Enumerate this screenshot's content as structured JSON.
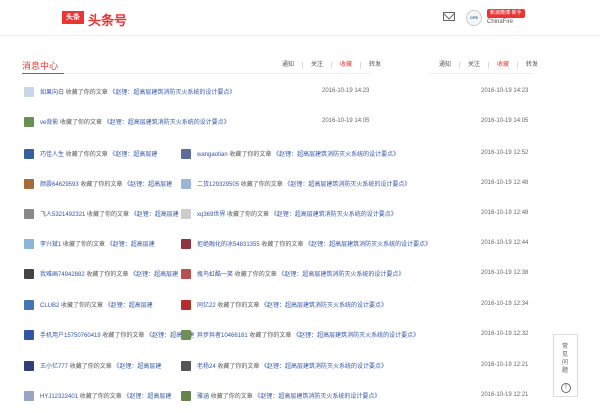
{
  "header": {
    "logo_text": "头条",
    "app_title": "头条号",
    "badge": "新浪微博·新手",
    "user_name": "ChinaFire",
    "avatar_text": "CFE"
  },
  "page": {
    "title": "消息中心",
    "tabs_left": [
      "通知",
      "关注",
      "收藏",
      "转发"
    ],
    "tabs_right": [
      "通知",
      "关注",
      "收藏",
      "转发"
    ]
  },
  "rows": [
    {
      "name": "如果向白",
      "action": "收藏了你的文章",
      "article": "《赵锂：超高层建筑消防灭火系统的设计要点》",
      "time": "2016-10-19 14:23"
    },
    {
      "name": "ve背影",
      "action": "收藏了你的文章",
      "article": "《赵锂：超高层建筑消防灭火系统的设计要点》",
      "time": "2016-10-19 14:05"
    },
    {
      "name": "巧佳人生",
      "action": "收藏了你的文章",
      "article": "《赵锂：超高层建",
      "time": "2016-10-19 12:52"
    },
    {
      "name": "颜震64629593",
      "action": "收藏了你的文章",
      "article": "《赵锂：超高层建",
      "time": "2016-10-19 12:48"
    },
    {
      "name": "飞人5321492321",
      "action": "收藏了你的文章",
      "article": "《赵锂：超高层建",
      "time": "2016-10-19 12:48"
    },
    {
      "name": "李兴斌1",
      "action": "收藏了你的文章",
      "article": "《赵锂：超高层建",
      "time": "2016-10-19 12:44"
    },
    {
      "name": "我难画74942882",
      "action": "收藏了你的文章",
      "article": "《赵锂：超高层建",
      "time": "2016-10-19 12:38"
    },
    {
      "name": "CLUB2",
      "action": "收藏了你的文章",
      "article": "《赵锂：超高层建",
      "time": "2016-10-19 12:34"
    },
    {
      "name": "手机用户15750760419",
      "action": "收藏了你的文章",
      "article": "《赵锂：超高层建",
      "time": "2016-10-19 12:32"
    },
    {
      "name": "王小亿777",
      "action": "收藏了你的文章",
      "article": "《赵锂：超高层建",
      "time": "2016-10-19 12:21"
    },
    {
      "name": "HYJ12322401",
      "action": "收藏了你的文章",
      "article": "《赵锂：超高层建",
      "time": "2016-10-19 12:21"
    }
  ],
  "right_rows": [
    {
      "name": "wangaotian",
      "action": "收藏了你的文章",
      "article": "《赵锂：超高层建筑消防灭火系统的设计要点》"
    },
    {
      "name": "二货129329505",
      "action": "收藏了你的文章",
      "article": "《赵锂：超高层建筑消防灭火系统的设计要点》"
    },
    {
      "name": "xq369世界",
      "action": "收藏了你的文章",
      "article": "《赵锂：超高层建筑消防灭火系统的设计要点》"
    },
    {
      "name": "拒绝融化的冰54831355",
      "action": "收藏了你的文章",
      "article": "《赵锂：超高层建筑消防灭火系统的设计要点》"
    },
    {
      "name": "瓶鸟虹酷一笑",
      "action": "收藏了你的文章",
      "article": "《赵锂：超高层建筑消防灭火系统的设计要点》"
    },
    {
      "name": "同亿22",
      "action": "收藏了你的文章",
      "article": "《赵锂：超高层建筑消防灭火系统的设计要点》"
    },
    {
      "name": "异步异者10466181",
      "action": "收藏了你的文章",
      "article": "《赵锂：超高层建筑消防灭火系统的设计要点》"
    },
    {
      "name": "老杨24",
      "action": "收藏了你的文章",
      "article": "《赵锂：超高层建筑消防灭火系统的设计要点》"
    },
    {
      "name": "雅涵",
      "action": "收藏了你的文章",
      "article": "《赵锂：超高层建筑消防灭火系统的设计要点》"
    }
  ],
  "side": {
    "help": "常见问题",
    "info": "!"
  }
}
